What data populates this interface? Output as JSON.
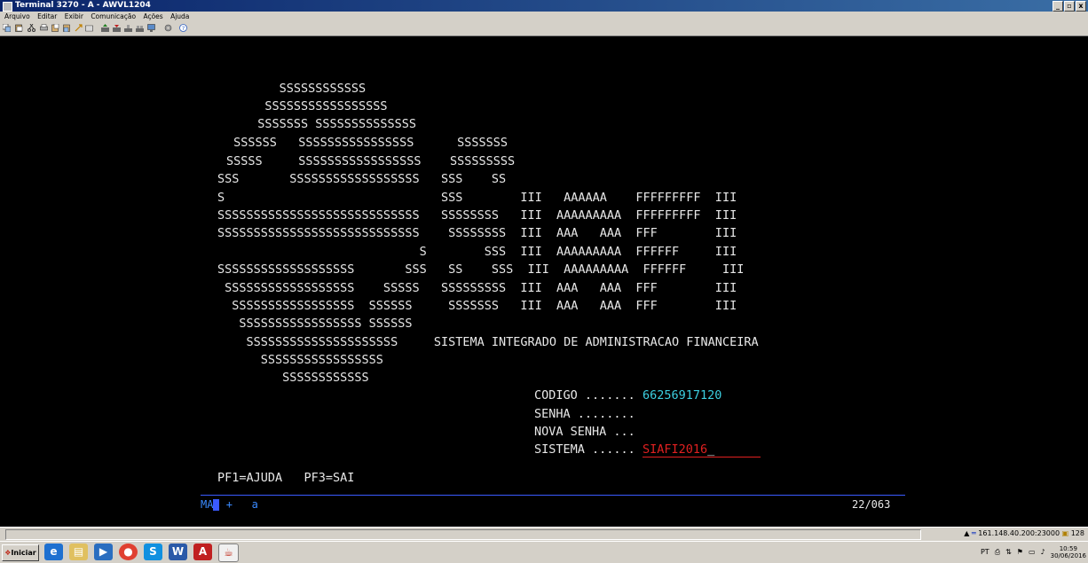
{
  "window": {
    "title": "Terminal 3270 - A - AWVL1204",
    "controls": [
      "_",
      "▫",
      "x"
    ]
  },
  "menu": {
    "items": [
      "Arquivo",
      "Editar",
      "Exibir",
      "Comunicação",
      "Ações",
      "Ajuda"
    ]
  },
  "toolbar": {
    "icons": [
      "copy-icon",
      "paste-icon",
      "cut-icon",
      "print-icon",
      "send-icon",
      "receive-icon",
      "macro-icon",
      "keyboard-icon",
      "upload-icon",
      "download-icon",
      "transfer-icon",
      "transfer2-icon",
      "monitor-icon",
      "gear-icon",
      "help-icon"
    ]
  },
  "screen": {
    "logo_lines": [
      "     SSSSSSSSSSSS",
      "   SSSSSSSSSSSSSSSSS",
      "  SSSSSSS SSSSSSSSSSSSSS",
      " SSSSSS   SSSSSSSSSSSSSSSS      SSSSSSS",
      "SSSSS     SSSSSSSSSSSSSSSSS    SSSSSSSSS",
      "SSS       SSSSSSSSSSSSSSSSSS   SSS    SS",
      "S                              SSS        III   AAAAAA    FFFFFFFFF  III",
      "SSSSSSSSSSSSSSSSSSSSSSSSSSSS   SSSSSSSS   III  AAAAAAAAA  FFFFFFFFF  III",
      "SSSSSSSSSSSSSSSSSSSSSSSSSSSS    SSSSSSSS  III  AAA   AAA  FFF        III",
      "                            S        SSS  III  AAAAAAAAA  FFFFFF     III",
      "SSSSSSSSSSSSSSSSSSS       SSS   SS    SSS  III  AAAAAAAAA  FFFFFF     III",
      " SSSSSSSSSSSSSSSSSS    SSSSS   SSSSSSSSS  III  AAA   AAA  FFF        III",
      "  SSSSSSSSSSSSSSSSS  SSSSSS     SSSSSSS   III  AAA   AAA  FFF        III",
      "   SSSSSSSSSSSSSSSSS SSSSSS",
      "    SSSSSSSSSSSSSSSSSSSSS     SISTEMA INTEGRADO DE ADMINISTRACAO FINANCEIRA",
      "      SSSSSSSSSSSSSSSSS",
      "         SSSSSSSSSSSS"
    ],
    "login": {
      "codigo_label": "CODIGO .......",
      "codigo_value": "66256917120",
      "senha_label": "SENHA ........",
      "nova_senha_label": "NOVA SENHA ...",
      "sistema_label": "SISTEMA ......",
      "sistema_value": "SIAFI2016",
      "sistema_cursor": "_"
    },
    "pf_keys": "PF1=AJUDA   PF3=SAI",
    "oia": {
      "left": "MA",
      "mid": "+   a",
      "cursor_pos": "22/063"
    }
  },
  "hostbar": {
    "address": "161.148.40.200:23000",
    "session_count": "128"
  },
  "taskbar": {
    "start_label": "Iniciar",
    "tray_lang": "PT",
    "time": "10:59",
    "date": "30/06/2016"
  },
  "colors": {
    "terminal_bg": "#000000",
    "terminal_text": "#e8e8e8",
    "field_cyan": "#3ccfe0",
    "field_red": "#e02020",
    "oia_blue": "#3a5aff"
  }
}
